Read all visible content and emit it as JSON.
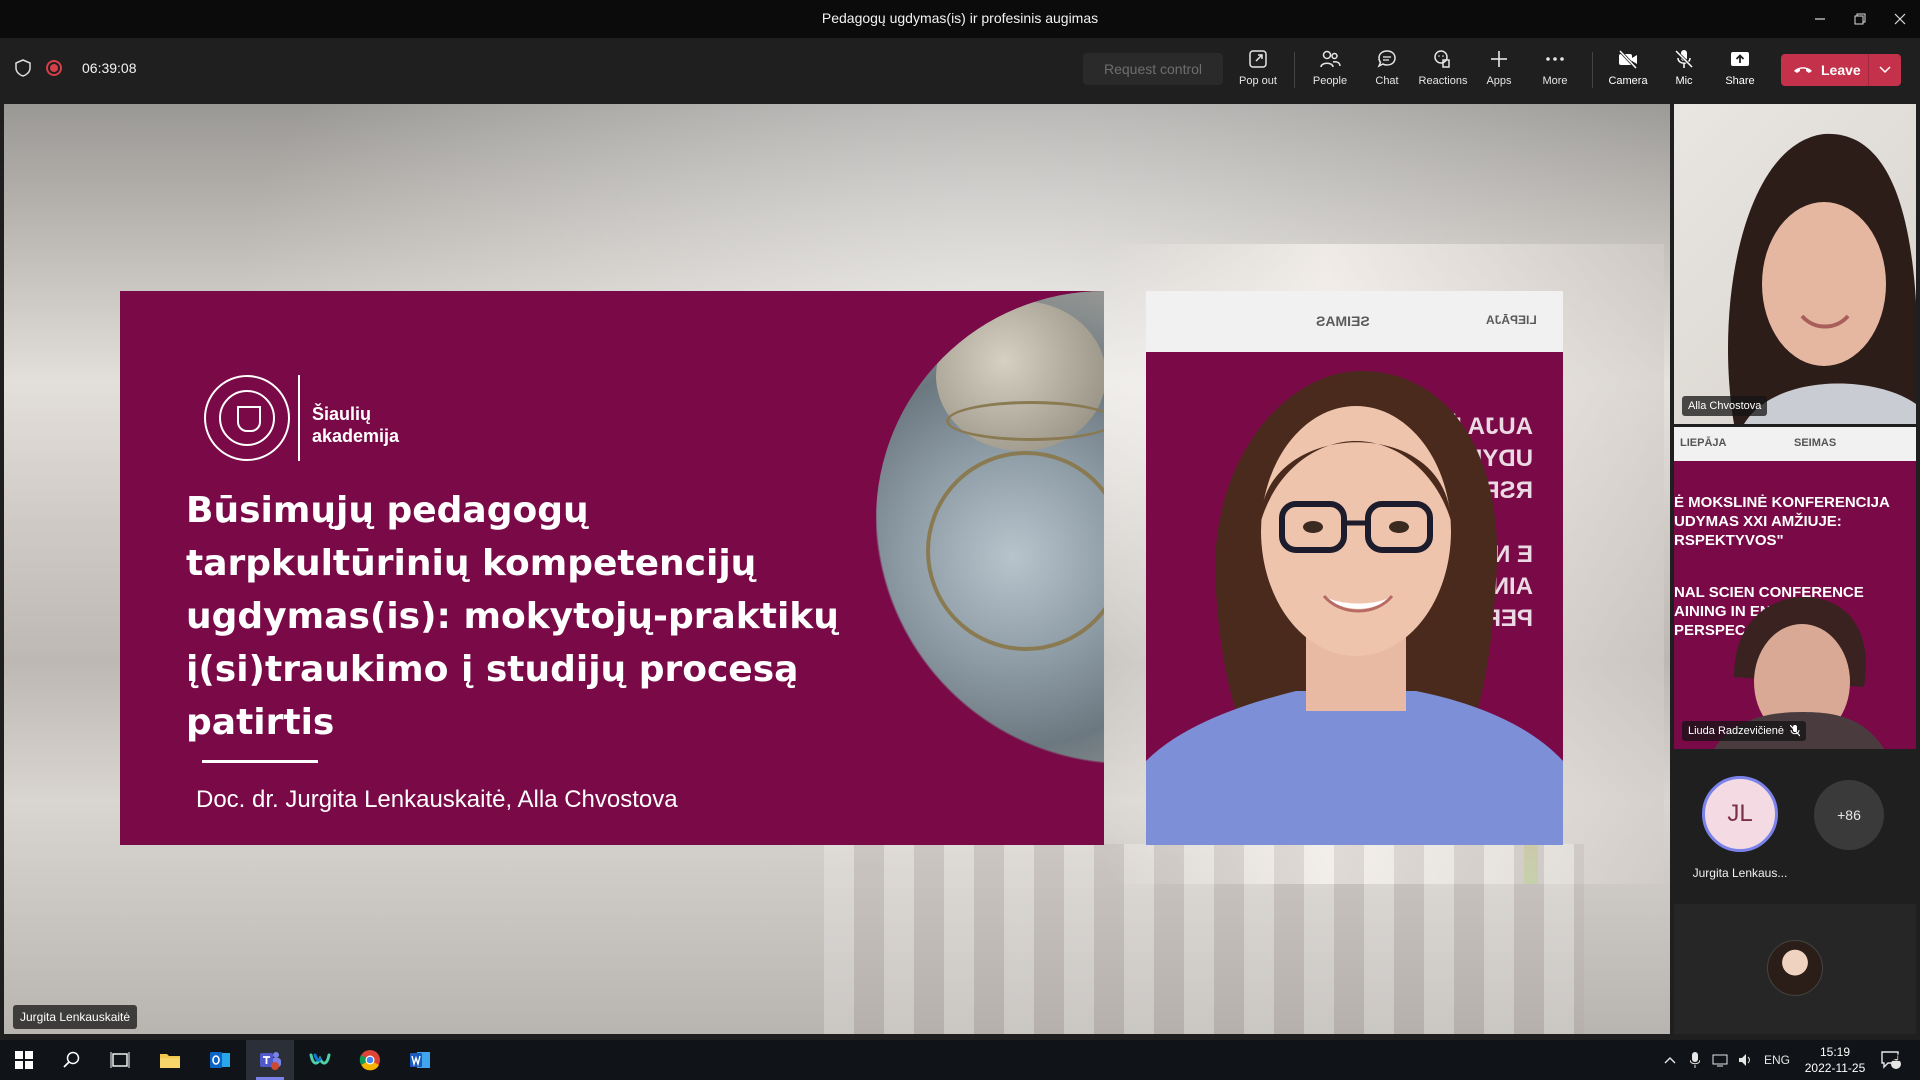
{
  "window": {
    "title": "Pedagogų ugdymas(is) ir profesinis augimas"
  },
  "toolbar": {
    "timer": "06:39:08",
    "request_control": "Request control",
    "buttons": [
      {
        "label": "Pop out",
        "icon": "pop-out-icon"
      },
      {
        "label": "People",
        "icon": "people-icon"
      },
      {
        "label": "Chat",
        "icon": "chat-icon"
      },
      {
        "label": "Reactions",
        "icon": "reactions-icon"
      },
      {
        "label": "Apps",
        "icon": "apps-icon"
      },
      {
        "label": "More",
        "icon": "more-icon"
      },
      {
        "label": "Camera",
        "icon": "camera-off-icon"
      },
      {
        "label": "Mic",
        "icon": "mic-off-icon"
      },
      {
        "label": "Share",
        "icon": "share-icon"
      }
    ],
    "leave_label": "Leave"
  },
  "slide": {
    "logo_text": "Šiaulių\nakademija",
    "title": "Būsimųjų pedagogų tarpkultūrinių kompetencijų ugdymas(is): mokytojų-praktikų į(si)traukimo į studijų procesą patirtis",
    "authors": "Doc. dr. Jurgita Lenkauskaitė, Alla Chvostova"
  },
  "presenter_tile": {
    "logo_left": "SEIMAS",
    "logo_right": "LIEPĀJA",
    "bg_text": "AUJA  Ė MOKSLINĖ\n UDYMAS XXI\n RSPEKTYV\n\nE  NAL SCIEN\n  AINING IN\n  PERSPEC"
  },
  "participants": {
    "tile1_name": "Alla Chvostova",
    "tile2_name": "Liuda Radzevičienė",
    "tile2_logos": [
      "LIEPĀJA",
      "SEIMAS"
    ],
    "tile2_text1": "Ė MOKSLINĖ KONFERENCIJA\nUDYMAS XXI AMŽIUJE:\nRSPEKTYVOS\"",
    "tile2_text2": "NAL SCIEN    CONFERENCE\nAINING IN     ENTURY:\nPERSPEC",
    "jl_initials": "JL",
    "jl_name": "Jurgita Lenkaus...",
    "more_count": "+86"
  },
  "presenter_name": "Jurgita Lenkauskaitė",
  "taskbar": {
    "lang": "ENG",
    "time": "15:19",
    "date": "2022-11-25",
    "notification_count": "11",
    "apps": [
      "start",
      "search",
      "task-view",
      "file-explorer",
      "outlook",
      "teams",
      "webex",
      "chrome",
      "word"
    ]
  },
  "colors": {
    "slide_bg": "#7a0a47",
    "leave_red": "#c4314b",
    "teams_accent": "#7b83eb"
  }
}
